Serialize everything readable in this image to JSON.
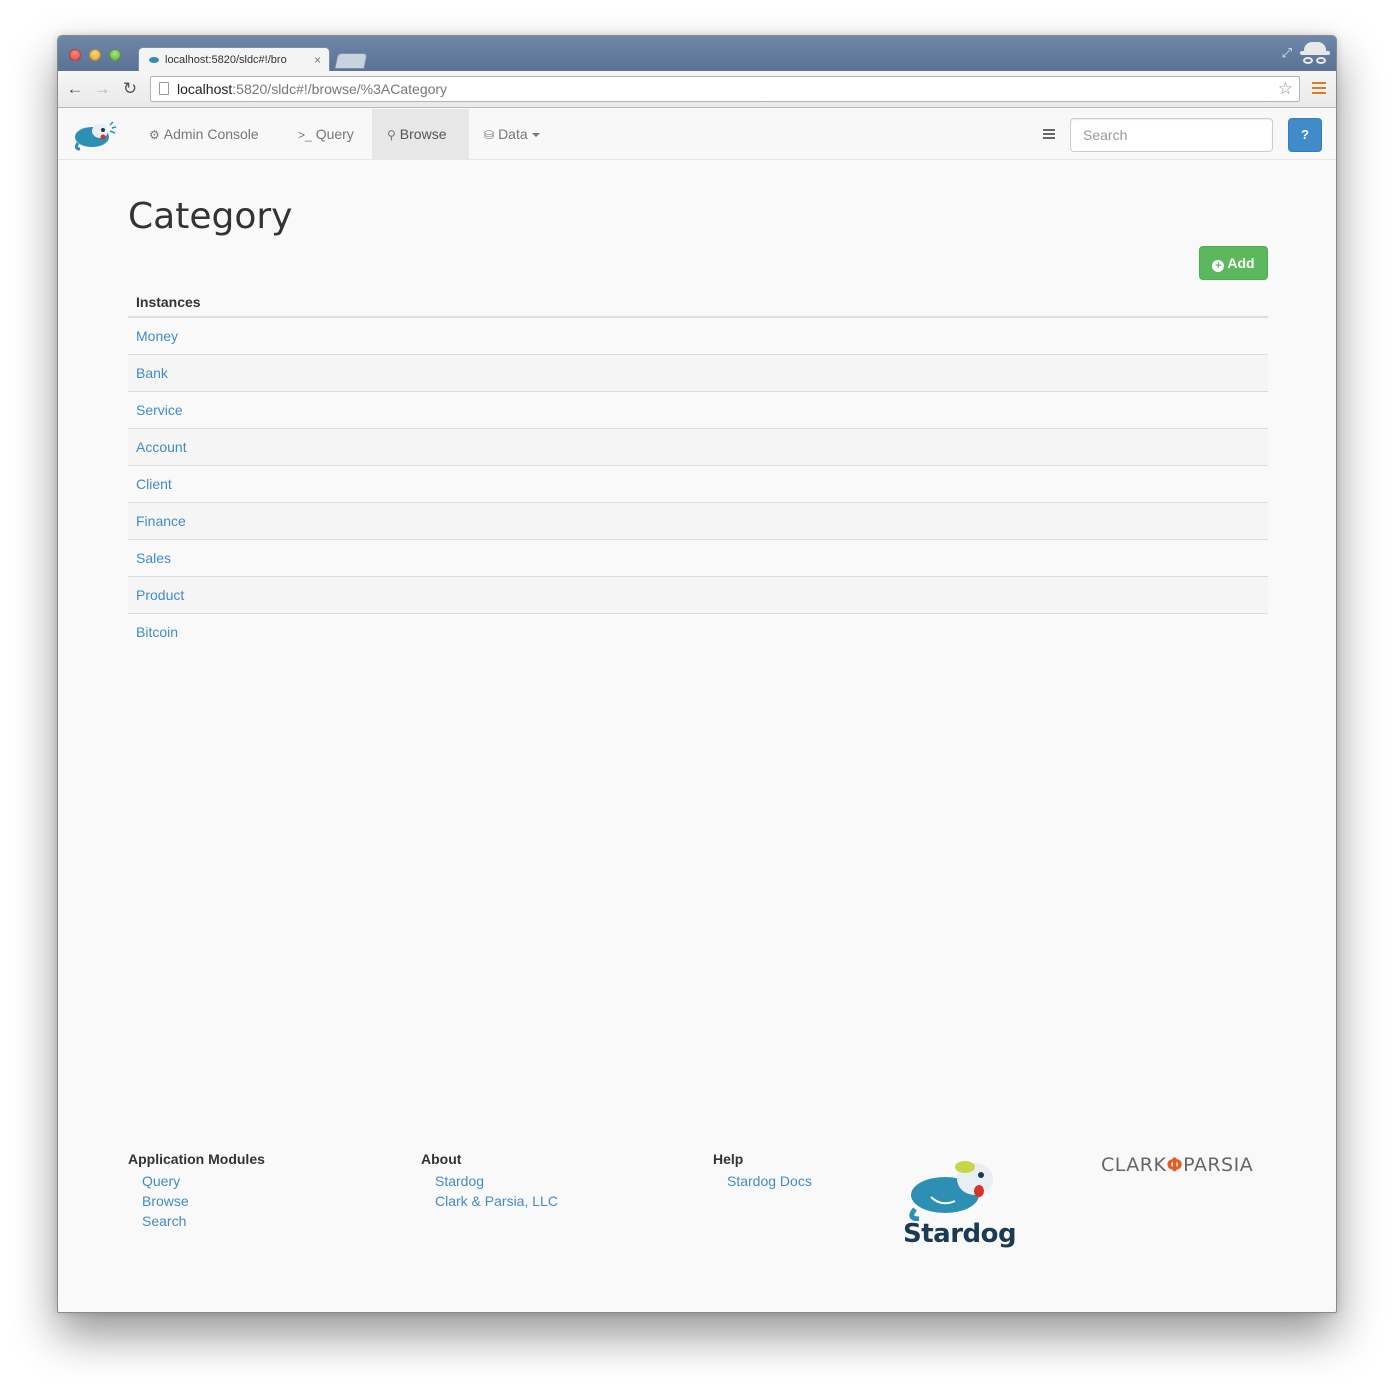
{
  "browser": {
    "tab_title": "localhost:5820/sldc#!/bro",
    "tab_close": "×",
    "url_host": "localhost",
    "url_rest": ":5820/sldc#!/browse/%3ACategory"
  },
  "nav": {
    "admin_label": "Admin Console",
    "query_label": "Query",
    "browse_label": "Browse",
    "data_label": "Data",
    "search_placeholder": "Search",
    "help_label": "?"
  },
  "page": {
    "title": "Category",
    "add_label": "Add",
    "table_header": "Instances",
    "instances": [
      "Money",
      "Bank",
      "Service",
      "Account",
      "Client",
      "Finance",
      "Sales",
      "Product",
      "Bitcoin"
    ]
  },
  "footer": {
    "modules_heading": "Application Modules",
    "modules_links": [
      "Query",
      "Browse",
      "Search"
    ],
    "about_heading": "About",
    "about_links": [
      "Stardog",
      "Clark & Parsia, LLC"
    ],
    "help_heading": "Help",
    "help_links": [
      "Stardog Docs"
    ],
    "stardog_logo_text": "Stardog",
    "cp_left": "CLARK",
    "cp_right": "PARSIA"
  },
  "colors": {
    "link": "#428bca",
    "add_button": "#5cb85c",
    "help_button": "#428bca",
    "brand_teal": "#2c8fb3"
  }
}
